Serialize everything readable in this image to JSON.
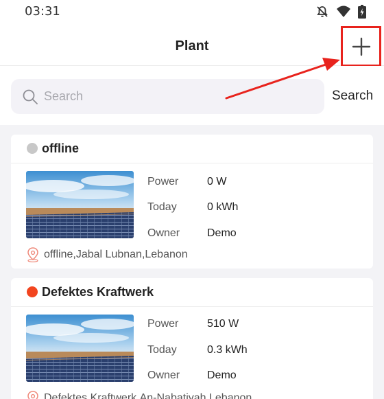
{
  "status_bar": {
    "time": "03:31",
    "icons": [
      "bell-off-icon",
      "wifi-icon",
      "battery-icon"
    ]
  },
  "header": {
    "title": "Plant",
    "add_icon": "plus-icon"
  },
  "search": {
    "placeholder": "Search",
    "button_label": "Search"
  },
  "labels": {
    "power": "Power",
    "today": "Today",
    "owner": "Owner"
  },
  "plants": [
    {
      "status_color": "#c8c8c8",
      "name": "offline",
      "power": "0 W",
      "today": "0 kWh",
      "owner": "Demo",
      "location": "offline,Jabal Lubnan,Lebanon"
    },
    {
      "status_color": "#f2451f",
      "name": "Defektes Kraftwerk",
      "power": "510 W",
      "today": "0.3 kWh",
      "owner": "Demo",
      "location": "Defektes Kraftwerk,An-Nabatiyah,Lebanon"
    }
  ],
  "colors": {
    "annotation": "#e8231d"
  }
}
